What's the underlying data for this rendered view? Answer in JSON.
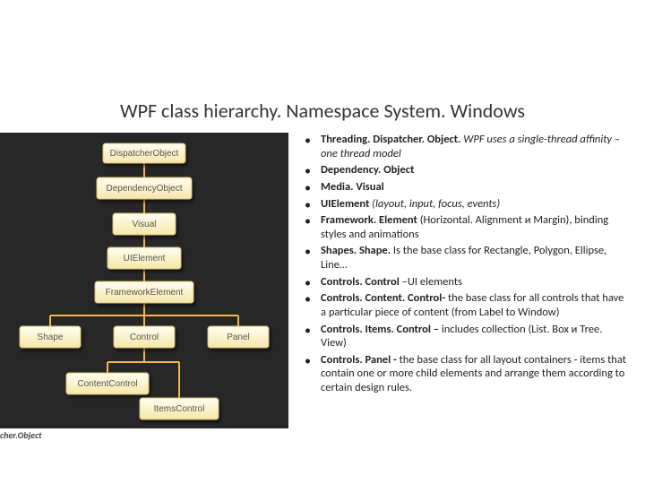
{
  "title": "WPF class hierarchy. Namespace System. Windows",
  "diagram": {
    "nodes": {
      "dispatcher": "DispatcherObject",
      "dependency": "DependencyObject",
      "visual": "Visual",
      "uielement": "UIElement",
      "framework": "FrameworkElement",
      "shape": "Shape",
      "control": "Control",
      "panel": "Panel",
      "contentcontrol": "ContentControl",
      "itemscontrol": "ItemsControl"
    }
  },
  "bullets": [
    {
      "bold": "Threading. Dispatcher. Object.",
      "rest": " WPF uses a single-thread affinity – one thread model",
      "italicRest": true
    },
    {
      "bold": "Dependency. Object",
      "rest": ""
    },
    {
      "bold": "Media. Visual",
      "rest": ""
    },
    {
      "bold": "UIElement",
      "rest": " (layout, input, focus, events)",
      "italicRest": true
    },
    {
      "bold": "Framework. Element",
      "rest": " (Horizontal. Alignment и Margin), binding styles and animations"
    },
    {
      "bold": "Shapes. Shape.",
      "rest": " Is the base class for Rectangle, Polygon, Ellipse, Line…"
    },
    {
      "bold": "Controls. Control",
      "rest": " –UI elements"
    },
    {
      "bold": "Controls. Content. Control-",
      "rest": " the base class for all controls that have a particular piece of content (from Label to Window)"
    },
    {
      "bold": "Controls. Items. Control –",
      "rest": " includes collection (List. Box и Tree. View)"
    },
    {
      "bold": "Controls. Panel -",
      "rest": " the base class for all layout containers - items that contain one or more child elements and arrange them according to certain design rules."
    }
  ],
  "footer_fragment": "cher.Object"
}
